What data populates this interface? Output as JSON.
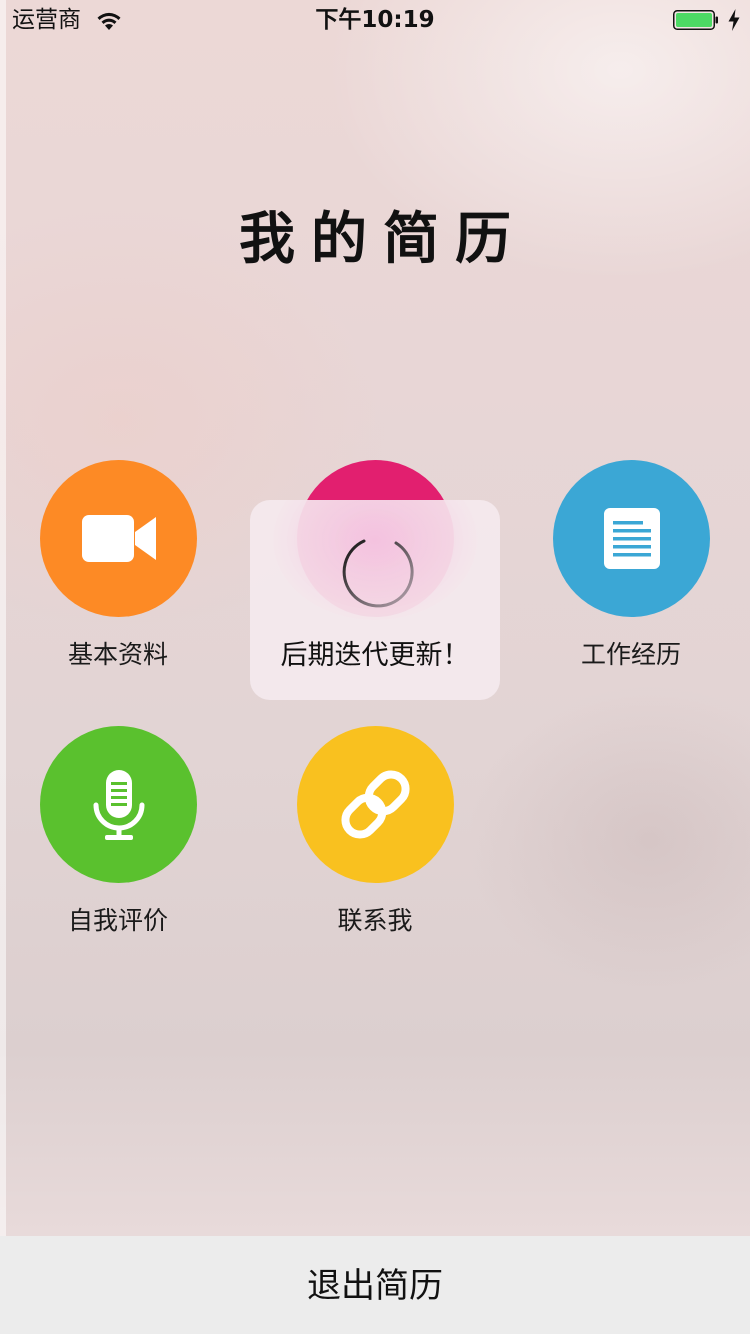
{
  "status_bar": {
    "carrier": "运营商",
    "time": "下午10:19",
    "wifi_icon": "wifi-icon",
    "battery_icon": "battery-icon",
    "charging_icon": "charging-bolt-icon",
    "battery_level": 1.0,
    "battery_color": "#4cd964"
  },
  "page": {
    "title": "我的简历"
  },
  "menu": {
    "items": [
      {
        "label": "基本资料",
        "icon": "video-camera-icon",
        "color": "#fd8a25"
      },
      {
        "label": "",
        "icon": "",
        "color": "#e21f6f"
      },
      {
        "label": "工作经历",
        "icon": "document-icon",
        "color": "#3ba7d5"
      },
      {
        "label": "自我评价",
        "icon": "microphone-icon",
        "color": "#5ac12e"
      },
      {
        "label": "联系我",
        "icon": "link-icon",
        "color": "#f9c11f"
      }
    ]
  },
  "toast": {
    "message": "后期迭代更新！",
    "spinner_icon": "loading-spinner-icon"
  },
  "bottom": {
    "exit_label": "退出简历"
  }
}
